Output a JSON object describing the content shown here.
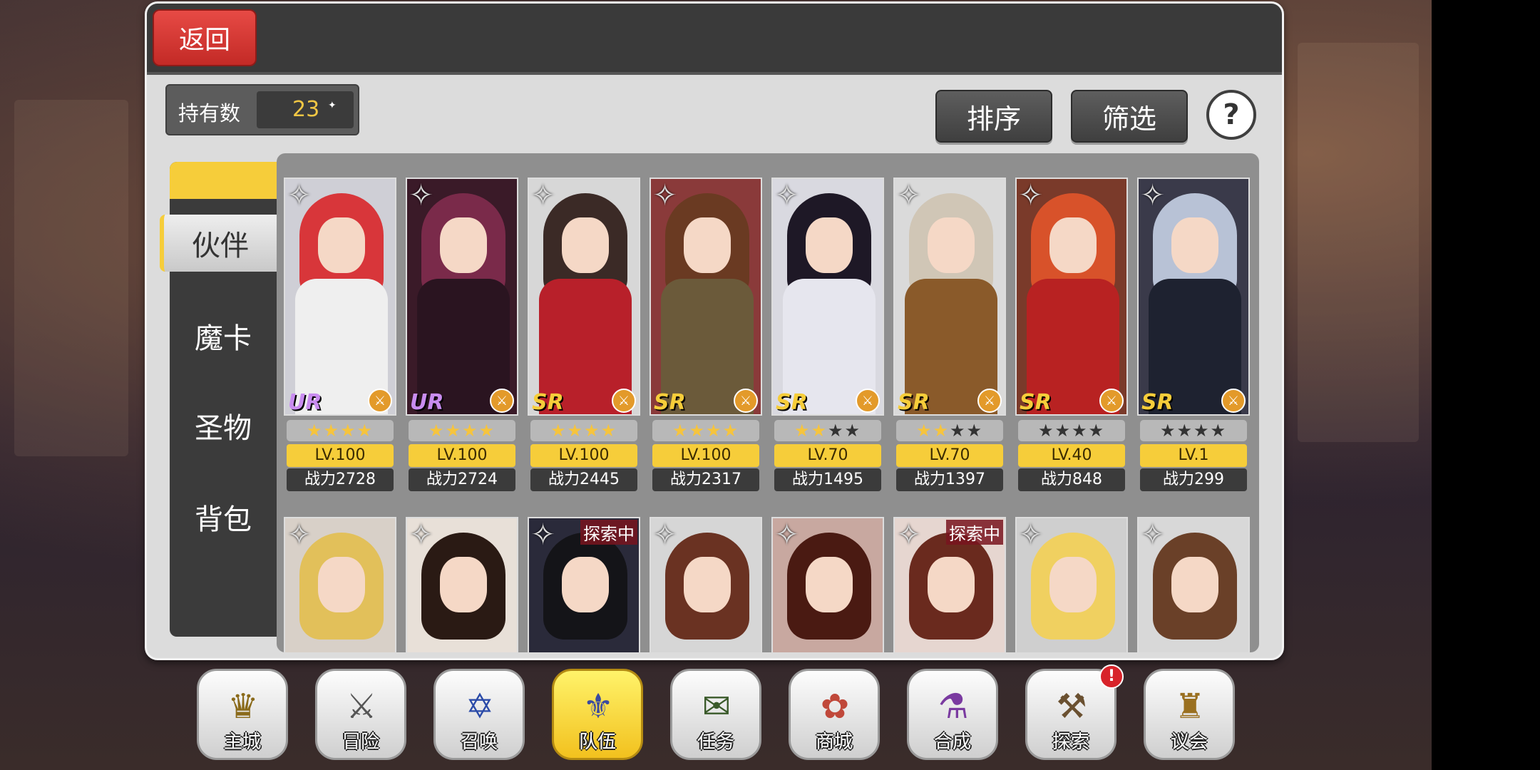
{
  "header": {
    "back_label": "返回"
  },
  "owned": {
    "label": "持有数",
    "count": "23"
  },
  "toolbar": {
    "sort_label": "排序",
    "filter_label": "筛选",
    "help_label": "?"
  },
  "sidebar": {
    "items": [
      {
        "label": "伙伴",
        "active": true
      },
      {
        "label": "魔卡",
        "active": false
      },
      {
        "label": "圣物",
        "active": false
      },
      {
        "label": "背包",
        "active": false
      }
    ]
  },
  "cards_row1": [
    {
      "rarity": "UR",
      "stars": "★★★★",
      "level": "LV.100",
      "power": "战力2728",
      "hair": "#d8363a",
      "outfit": "#efefef",
      "bg": "#cfcfd6"
    },
    {
      "rarity": "UR",
      "stars": "★★★★",
      "level": "LV.100",
      "power": "战力2724",
      "hair": "#7a2a4a",
      "outfit": "#2a1420",
      "bg": "#3a1a28"
    },
    {
      "rarity": "SR",
      "stars": "★★★★",
      "level": "LV.100",
      "power": "战力2445",
      "hair": "#3b2a26",
      "outfit": "#b8202a",
      "bg": "#d7d7d7"
    },
    {
      "rarity": "SR",
      "stars": "★★★★",
      "level": "LV.100",
      "power": "战力2317",
      "hair": "#6a3a22",
      "outfit": "#6b5a3a",
      "bg": "#8a3a3a"
    },
    {
      "rarity": "SR",
      "stars": "★★★★",
      "level": "LV.70",
      "power": "战力1495",
      "hair": "#1e1826",
      "outfit": "#e6e6ee",
      "bg": "#d9d9e0"
    },
    {
      "rarity": "SR",
      "stars": "★★★★",
      "level": "LV.70",
      "power": "战力1397",
      "hair": "#d0c6b6",
      "outfit": "#8a5a2a",
      "bg": "#dadada"
    },
    {
      "rarity": "SR",
      "stars": "★★★★",
      "level": "LV.40",
      "power": "战力848",
      "hair": "#d8522a",
      "outfit": "#b82222",
      "bg": "#7a3a2a"
    },
    {
      "rarity": "SR",
      "stars": "★★★★",
      "level": "LV.1",
      "power": "战力299",
      "hair": "#b8c2d6",
      "outfit": "#1e2230",
      "bg": "#3a3a4a"
    }
  ],
  "star_states": [
    [
      true,
      true,
      true,
      true
    ],
    [
      true,
      true,
      true,
      true
    ],
    [
      true,
      true,
      true,
      true
    ],
    [
      true,
      true,
      true,
      true
    ],
    [
      true,
      true,
      false,
      false
    ],
    [
      true,
      true,
      false,
      false
    ],
    [
      false,
      false,
      false,
      false
    ],
    [
      false,
      false,
      false,
      false
    ]
  ],
  "cards_row2": [
    {
      "badge": "",
      "hair": "#e2c05a",
      "bg": "#d8d0c8"
    },
    {
      "badge": "",
      "hair": "#2a1a14",
      "bg": "#e8e0d8"
    },
    {
      "badge": "探索中",
      "hair": "#141418",
      "bg": "#2a2a3a"
    },
    {
      "badge": "",
      "hair": "#6a3222",
      "bg": "#d6d6d6"
    },
    {
      "badge": "",
      "hair": "#4a1a12",
      "bg": "#c8a8a0"
    },
    {
      "badge": "探索中",
      "hair": "#6a2a1e",
      "bg": "#e6d6d0"
    },
    {
      "badge": "",
      "hair": "#f0d060",
      "bg": "#cfcfcf"
    },
    {
      "badge": "",
      "hair": "#6a4028",
      "bg": "#d8d8d8"
    }
  ],
  "bottom_nav": [
    {
      "label": "主城",
      "icon": "crown-icon",
      "glyph": "♛",
      "color": "#8a6a1a"
    },
    {
      "label": "冒险",
      "icon": "crossed-swords-icon",
      "glyph": "⚔",
      "color": "#555"
    },
    {
      "label": "召唤",
      "icon": "summon-card-icon",
      "glyph": "✡",
      "color": "#2a4aa8"
    },
    {
      "label": "队伍",
      "icon": "winged-emblem-icon",
      "glyph": "⚜",
      "color": "#3a4aa0"
    },
    {
      "label": "任务",
      "icon": "quest-book-icon",
      "glyph": "✉",
      "color": "#3a5a2a"
    },
    {
      "label": "商城",
      "icon": "shop-tree-icon",
      "glyph": "✿",
      "color": "#c0483a"
    },
    {
      "label": "合成",
      "icon": "potion-flask-icon",
      "glyph": "⚗",
      "color": "#7a3aa0"
    },
    {
      "label": "探索",
      "icon": "compass-shovel-icon",
      "glyph": "⚒",
      "color": "#6a5030"
    },
    {
      "label": "议会",
      "icon": "council-crest-icon",
      "glyph": "♜",
      "color": "#9a7020"
    }
  ],
  "alert": "!"
}
